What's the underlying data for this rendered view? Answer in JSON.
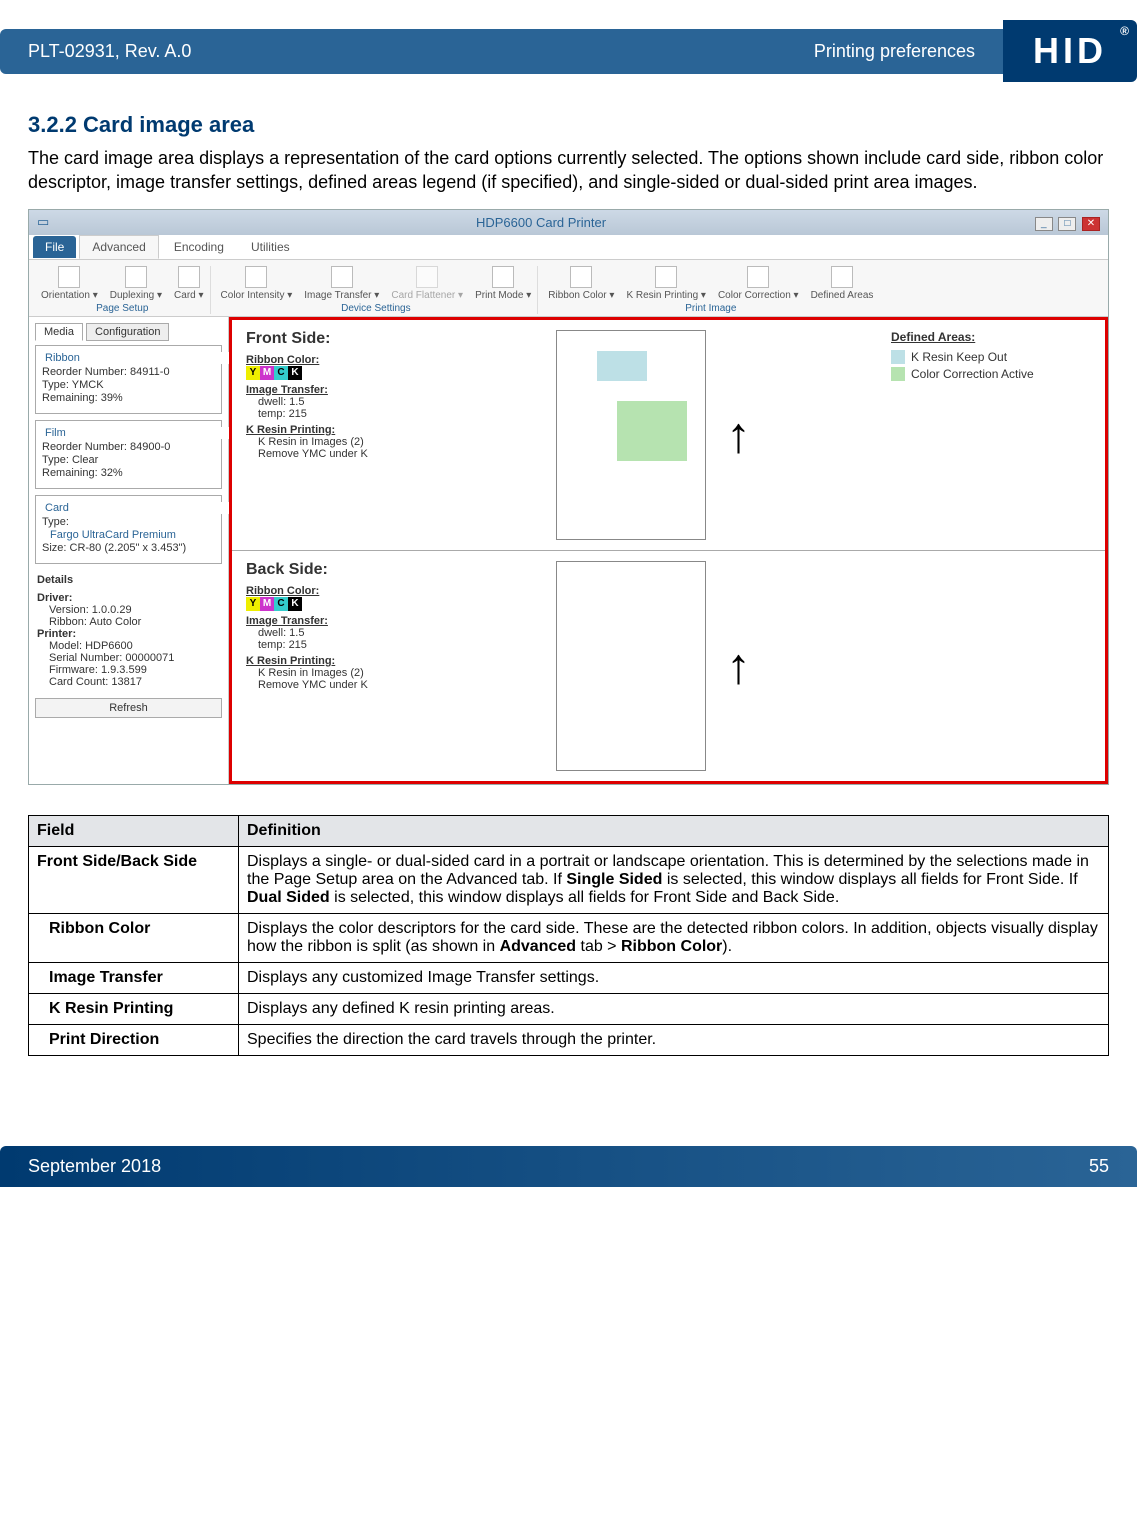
{
  "header": {
    "docnum": "PLT-02931, Rev. A.0",
    "title": "Printing preferences",
    "brand": "HID"
  },
  "section": {
    "num_title": "3.2.2 Card image area",
    "intro": "The card image area displays a representation of the card options currently selected. The options shown include card side, ribbon color descriptor, image transfer settings, defined areas legend (if specified), and single-sided or dual-sided print area images."
  },
  "window": {
    "title": "HDP6600 Card Printer",
    "tabs": {
      "file": "File",
      "advanced": "Advanced",
      "encoding": "Encoding",
      "utilities": "Utilities"
    },
    "groups": {
      "page_setup": {
        "label": "Page Setup",
        "items": [
          "Orientation",
          "Duplexing",
          "Card"
        ]
      },
      "device": {
        "label": "Device Settings",
        "items": [
          "Color Intensity",
          "Image Transfer",
          "Card Flattener",
          "Print Mode"
        ]
      },
      "print_image": {
        "label": "Print Image",
        "items": [
          "Ribbon Color",
          "K Resin Printing",
          "Color Correction",
          "Defined Areas"
        ]
      }
    },
    "side_tabs": {
      "media": "Media",
      "config": "Configuration"
    },
    "ribbon": {
      "legend": "Ribbon",
      "reorder": "Reorder Number: 84911-0",
      "type": "Type: YMCK",
      "remain": "Remaining: 39%"
    },
    "film": {
      "legend": "Film",
      "reorder": "Reorder Number: 84900-0",
      "type": "Type: Clear",
      "remain": "Remaining: 32%"
    },
    "card": {
      "legend": "Card",
      "type": "Type:",
      "typeval": "Fargo UltraCard Premium",
      "size": "Size: CR-80 (2.205\" x 3.453\")"
    },
    "details": {
      "title": "Details",
      "driver": "Driver:",
      "dver": "Version: 1.0.0.29",
      "drib": "Ribbon: Auto Color",
      "printer": "Printer:",
      "pmodel": "Model: HDP6600",
      "pserial": "Serial Number: 00000071",
      "pfw": "Firmware: 1.9.3.599",
      "pcount": "Card Count: 13817"
    },
    "refresh": "Refresh",
    "front": {
      "title": "Front Side:",
      "rc": "Ribbon Color:",
      "it": "Image Transfer:",
      "d1": "dwell: 1.5",
      "d2": "temp: 215",
      "kr": "K Resin Printing:",
      "k1": "K Resin in Images (2)",
      "k2": "Remove YMC under K"
    },
    "back": {
      "title": "Back Side:",
      "rc": "Ribbon Color:",
      "it": "Image Transfer:",
      "d1": "dwell: 1.5",
      "d2": "temp: 215",
      "kr": "K Resin Printing:",
      "k1": "K Resin in Images (2)",
      "k2": "Remove YMC under K"
    },
    "defined": {
      "title": "Defined Areas:",
      "i1": "K Resin Keep Out",
      "i2": "Color Correction Active"
    },
    "ymck": {
      "y": "Y",
      "m": "M",
      "c": "C",
      "k": "K"
    }
  },
  "table": {
    "h1": "Field",
    "h2": "Definition",
    "rows": [
      {
        "f": "Front Side/Back Side",
        "d_pre": "Displays a single- or dual-sided card in a portrait or landscape orientation. This is determined by the selections made in the Page Setup area on the Advanced tab. If ",
        "b1": "Single Sided",
        "d_mid": " is selected, this window displays all fields for Front Side. If ",
        "b2": "Dual Sided",
        "d_post": " is selected, this window displays all fields for Front Side and Back Side."
      },
      {
        "f": "Ribbon Color",
        "d_pre": "Displays the color descriptors for the card side. These are the detected ribbon colors. In addition, objects visually display how the ribbon is split (as shown in ",
        "b1": "Advanced",
        "d_mid": " tab > ",
        "b2": "Ribbon Color",
        "d_post": ")."
      },
      {
        "f": "Image Transfer",
        "d": "Displays any customized Image Transfer settings."
      },
      {
        "f": "K Resin Printing",
        "d": "Displays any defined K resin printing areas."
      },
      {
        "f": "Print Direction",
        "d": "Specifies the direction the card travels through the printer."
      }
    ]
  },
  "footer": {
    "date": "September 2018",
    "page": "55"
  }
}
